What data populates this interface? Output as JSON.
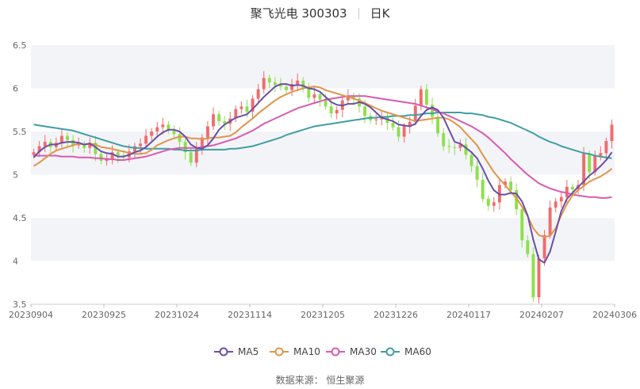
{
  "title": {
    "name": "聚飞光电 300303",
    "period": "日K"
  },
  "source_label": "数据来源：  恒生聚源",
  "colors": {
    "up": "#f26b6b",
    "down": "#8ce04a",
    "ma5": "#6a4fa6",
    "ma10": "#e0954a",
    "ma30": "#d95ab0",
    "ma60": "#3f9ea3",
    "band": "#f3f4f8"
  },
  "legend": [
    {
      "key": "ma5",
      "label": "MA5"
    },
    {
      "key": "ma10",
      "label": "MA10"
    },
    {
      "key": "ma30",
      "label": "MA30"
    },
    {
      "key": "ma60",
      "label": "MA60"
    }
  ],
  "chart_data": {
    "type": "candlestick",
    "xticks": [
      "20230904",
      "20230925",
      "20231024",
      "20231114",
      "20231205",
      "20231226",
      "20240117",
      "20240207",
      "20240306"
    ],
    "yticks": [
      "3.5",
      "4",
      "4.5",
      "5",
      "5.5",
      "6",
      "6.5"
    ],
    "ylim": [
      3.5,
      6.5
    ],
    "close": [
      5.26,
      5.33,
      5.38,
      5.32,
      5.37,
      5.45,
      5.4,
      5.34,
      5.35,
      5.31,
      5.37,
      5.24,
      5.16,
      5.19,
      5.26,
      5.22,
      5.2,
      5.27,
      5.33,
      5.36,
      5.45,
      5.5,
      5.55,
      5.58,
      5.51,
      5.47,
      5.38,
      5.26,
      5.14,
      5.3,
      5.43,
      5.56,
      5.7,
      5.62,
      5.59,
      5.65,
      5.76,
      5.79,
      5.73,
      5.88,
      5.99,
      6.12,
      6.07,
      6.04,
      6.02,
      5.98,
      6.05,
      6.09,
      6.0,
      5.89,
      5.93,
      5.87,
      5.79,
      5.71,
      5.75,
      5.86,
      5.91,
      5.88,
      5.79,
      5.68,
      5.63,
      5.64,
      5.67,
      5.6,
      5.55,
      5.44,
      5.56,
      5.61,
      5.8,
      5.99,
      5.81,
      5.67,
      5.48,
      5.33,
      5.32,
      5.31,
      5.35,
      5.23,
      5.1,
      4.94,
      4.72,
      4.64,
      4.68,
      4.88,
      4.92,
      4.82,
      4.6,
      4.24,
      4.08,
      3.58,
      4.03,
      4.3,
      4.62,
      4.69,
      4.74,
      4.86,
      4.83,
      4.88,
      5.24,
      5.03,
      5.22,
      5.25,
      5.39,
      5.58
    ],
    "ma5": [
      5.2,
      5.27,
      5.32,
      5.35,
      5.35,
      5.37,
      5.38,
      5.38,
      5.37,
      5.35,
      5.36,
      5.32,
      5.27,
      5.25,
      5.24,
      5.21,
      5.21,
      5.23,
      5.26,
      5.28,
      5.32,
      5.38,
      5.44,
      5.49,
      5.52,
      5.52,
      5.5,
      5.44,
      5.35,
      5.31,
      5.3,
      5.34,
      5.42,
      5.52,
      5.58,
      5.62,
      5.66,
      5.68,
      5.7,
      5.76,
      5.83,
      5.9,
      5.96,
      6.02,
      6.05,
      6.05,
      6.03,
      6.04,
      6.03,
      6.0,
      5.99,
      5.96,
      5.9,
      5.84,
      5.81,
      5.8,
      5.82,
      5.82,
      5.84,
      5.82,
      5.78,
      5.72,
      5.66,
      5.64,
      5.62,
      5.58,
      5.57,
      5.56,
      5.59,
      5.68,
      5.75,
      5.78,
      5.75,
      5.66,
      5.52,
      5.38,
      5.36,
      5.31,
      5.26,
      5.19,
      5.07,
      4.93,
      4.82,
      4.77,
      4.77,
      4.79,
      4.78,
      4.69,
      4.53,
      4.25,
      4.02,
      3.98,
      4.11,
      4.34,
      4.58,
      4.72,
      4.79,
      4.86,
      4.92,
      4.99,
      5.04,
      5.1,
      5.17,
      5.26
    ],
    "ma10": [
      5.1,
      5.14,
      5.19,
      5.24,
      5.28,
      5.3,
      5.32,
      5.34,
      5.36,
      5.35,
      5.36,
      5.35,
      5.32,
      5.31,
      5.3,
      5.28,
      5.27,
      5.25,
      5.24,
      5.24,
      5.25,
      5.29,
      5.34,
      5.37,
      5.4,
      5.42,
      5.44,
      5.44,
      5.42,
      5.42,
      5.41,
      5.42,
      5.43,
      5.43,
      5.44,
      5.45,
      5.49,
      5.55,
      5.6,
      5.65,
      5.71,
      5.76,
      5.81,
      5.86,
      5.9,
      5.93,
      5.96,
      5.98,
      6.0,
      6.01,
      6.02,
      6.01,
      5.98,
      5.96,
      5.94,
      5.92,
      5.9,
      5.88,
      5.86,
      5.83,
      5.8,
      5.77,
      5.74,
      5.72,
      5.7,
      5.68,
      5.66,
      5.64,
      5.62,
      5.63,
      5.64,
      5.65,
      5.66,
      5.66,
      5.64,
      5.6,
      5.55,
      5.48,
      5.41,
      5.34,
      5.23,
      5.13,
      5.03,
      4.95,
      4.88,
      4.8,
      4.73,
      4.63,
      4.52,
      4.38,
      4.3,
      4.28,
      4.29,
      4.38,
      4.53,
      4.66,
      4.76,
      4.82,
      4.87,
      4.92,
      4.95,
      4.98,
      5.02,
      5.07
    ],
    "ma30": [
      5.22,
      5.22,
      5.22,
      5.22,
      5.22,
      5.21,
      5.21,
      5.21,
      5.2,
      5.2,
      5.2,
      5.19,
      5.19,
      5.18,
      5.18,
      5.17,
      5.17,
      5.18,
      5.19,
      5.2,
      5.21,
      5.23,
      5.25,
      5.27,
      5.29,
      5.3,
      5.31,
      5.31,
      5.31,
      5.31,
      5.32,
      5.33,
      5.34,
      5.36,
      5.38,
      5.4,
      5.42,
      5.45,
      5.48,
      5.51,
      5.55,
      5.59,
      5.62,
      5.65,
      5.68,
      5.71,
      5.74,
      5.77,
      5.79,
      5.81,
      5.83,
      5.85,
      5.87,
      5.88,
      5.89,
      5.9,
      5.91,
      5.91,
      5.91,
      5.91,
      5.9,
      5.89,
      5.88,
      5.87,
      5.86,
      5.85,
      5.84,
      5.83,
      5.82,
      5.8,
      5.78,
      5.76,
      5.73,
      5.71,
      5.68,
      5.65,
      5.62,
      5.59,
      5.56,
      5.52,
      5.48,
      5.43,
      5.37,
      5.31,
      5.25,
      5.18,
      5.12,
      5.06,
      5.0,
      4.95,
      4.9,
      4.87,
      4.84,
      4.82,
      4.8,
      4.79,
      4.77,
      4.76,
      4.75,
      4.74,
      4.74,
      4.73,
      4.73,
      4.74
    ],
    "ma60": [
      5.58,
      5.57,
      5.56,
      5.55,
      5.54,
      5.53,
      5.52,
      5.51,
      5.49,
      5.47,
      5.45,
      5.43,
      5.41,
      5.39,
      5.37,
      5.35,
      5.33,
      5.32,
      5.31,
      5.31,
      5.3,
      5.3,
      5.3,
      5.3,
      5.3,
      5.29,
      5.29,
      5.28,
      5.28,
      5.28,
      5.29,
      5.29,
      5.29,
      5.29,
      5.29,
      5.3,
      5.3,
      5.31,
      5.32,
      5.33,
      5.35,
      5.37,
      5.39,
      5.41,
      5.43,
      5.46,
      5.48,
      5.5,
      5.52,
      5.54,
      5.56,
      5.57,
      5.58,
      5.59,
      5.6,
      5.61,
      5.62,
      5.63,
      5.64,
      5.65,
      5.66,
      5.66,
      5.67,
      5.67,
      5.68,
      5.68,
      5.68,
      5.69,
      5.69,
      5.7,
      5.71,
      5.71,
      5.72,
      5.72,
      5.72,
      5.72,
      5.72,
      5.71,
      5.71,
      5.7,
      5.69,
      5.67,
      5.66,
      5.64,
      5.62,
      5.6,
      5.57,
      5.54,
      5.51,
      5.48,
      5.44,
      5.41,
      5.38,
      5.36,
      5.33,
      5.31,
      5.29,
      5.27,
      5.25,
      5.24,
      5.22,
      5.21,
      5.2,
      5.19
    ],
    "legend_position": "bottom",
    "grid": "horizontal bands"
  }
}
